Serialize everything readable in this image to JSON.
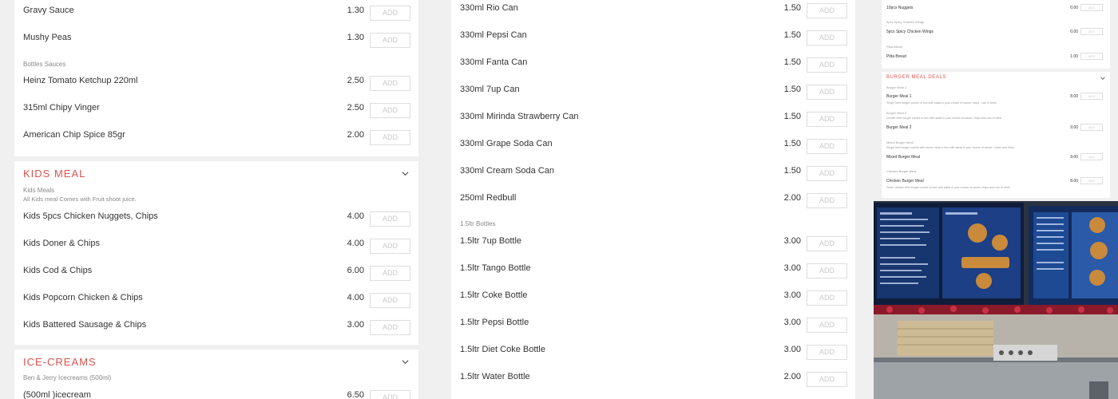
{
  "left_column": {
    "items_top": [
      {
        "name": "Gravy Sauce",
        "price": "1.30",
        "add": "ADD"
      },
      {
        "name": "Mushy Peas",
        "price": "1.30",
        "add": "ADD"
      }
    ],
    "bottles_sauces": {
      "subcategory": "Bottles Sauces",
      "items": [
        {
          "name": "Heinz Tomato Ketchup 220ml",
          "price": "2.50",
          "add": "ADD"
        },
        {
          "name": "315ml Chipy Vinger",
          "price": "2.50",
          "add": "ADD"
        },
        {
          "name": "American Chip Spice 85gr",
          "price": "2.00",
          "add": "ADD"
        }
      ]
    },
    "kids_meal": {
      "title": "KIDS MEAL",
      "subcategory": "Kids Meals",
      "description": "All Kids meal Comes with Fruit shoot juice.",
      "items": [
        {
          "name": "Kids 5pcs Chicken Nuggets, Chips",
          "price": "4.00",
          "add": "ADD"
        },
        {
          "name": "Kids Doner & Chips",
          "price": "4.00",
          "add": "ADD"
        },
        {
          "name": "Kids Cod & Chips",
          "price": "6.00",
          "add": "ADD"
        },
        {
          "name": "Kids Popcorn Chicken & Chips",
          "price": "4.00",
          "add": "ADD"
        },
        {
          "name": "Kids Battered Sausage & Chips",
          "price": "3.00",
          "add": "ADD"
        }
      ]
    },
    "ice_creams": {
      "title": "ICE-CREAMS",
      "subcategory": "Ben & Jerry Icecreams (500ml)",
      "items": [
        {
          "name": "(500ml )icecream",
          "price": "6.50",
          "add": "ADD"
        }
      ]
    }
  },
  "middle_column": {
    "cans": [
      {
        "name": "330ml Rio Can",
        "price": "1.50",
        "add": "ADD"
      },
      {
        "name": "330ml Pepsi Can",
        "price": "1.50",
        "add": "ADD"
      },
      {
        "name": "330ml Fanta Can",
        "price": "1.50",
        "add": "ADD"
      },
      {
        "name": "330ml 7up Can",
        "price": "1.50",
        "add": "ADD"
      },
      {
        "name": "330ml Mirinda Strawberry Can",
        "price": "1.50",
        "add": "ADD"
      },
      {
        "name": "330ml Grape Soda Can",
        "price": "1.50",
        "add": "ADD"
      },
      {
        "name": "330ml Cream Soda Can",
        "price": "1.50",
        "add": "ADD"
      },
      {
        "name": "250ml Redbull",
        "price": "2.00",
        "add": "ADD"
      }
    ],
    "bottles": {
      "subcategory": "1.5ltr Bottles",
      "items": [
        {
          "name": "1.5ltr 7up Bottle",
          "price": "3.00",
          "add": "ADD"
        },
        {
          "name": "1.5ltr Tango Bottle",
          "price": "3.00",
          "add": "ADD"
        },
        {
          "name": "1.5ltr Coke Bottle",
          "price": "3.00",
          "add": "ADD"
        },
        {
          "name": "1.5ltr Pepsi Bottle",
          "price": "3.00",
          "add": "ADD"
        },
        {
          "name": "1.5ltr Diet Coke Bottle",
          "price": "3.00",
          "add": "ADD"
        },
        {
          "name": "1.5ltr Water Bottle",
          "price": "2.00",
          "add": "ADD"
        }
      ]
    }
  },
  "right_column": {
    "top_items": [
      {
        "name": "10pcs Nuggets",
        "price": "0.00",
        "add": "ADD"
      }
    ],
    "spicy_sub": "5pcs Spicy Chicken Wings",
    "spicy_item": {
      "name": "5pcs Spicy Chicken Wings",
      "price": "0.00",
      "add": "ADD"
    },
    "pitta_sub": "Pitta Bread",
    "pitta_item": {
      "name": "Pitta Bread",
      "price": "1.00",
      "add": "ADD"
    },
    "burger_deals": {
      "title": "BURGER MEAL DEALS",
      "blocks": [
        {
          "sub": "Burger Meal 1",
          "name": "Burger Meal 1",
          "price": "8.00",
          "desc": "Single beef burger comes in box with salad & your choice of sauce, chips , can of drink",
          "add": "ADD"
        },
        {
          "sub": "Burger Meal 2",
          "name": "Burger Meal 2",
          "price": "9.00",
          "desc": "Double beef burger comes in box with salad & your choice of sauce, chips and can of drink",
          "add": "ADD"
        },
        {
          "sub": "Mixed Burger Meal",
          "name": "Mixed Burger Meal",
          "price": "9.00",
          "desc": "Single beef burger comes with doner meat in box with salad & your choice of sauce , chips and drink",
          "add": "ADD"
        },
        {
          "sub": "Chicken Burger Meal",
          "name": "Chicken Burger Meal",
          "price": "8.00",
          "desc": "Fresh chicken fillet burger comes in box with salad & your choice of sauce, chips and can of drink",
          "add": "ADD"
        }
      ]
    }
  },
  "colors": {
    "accent": "#d9534f",
    "page_bg": "#f0f0f1"
  }
}
